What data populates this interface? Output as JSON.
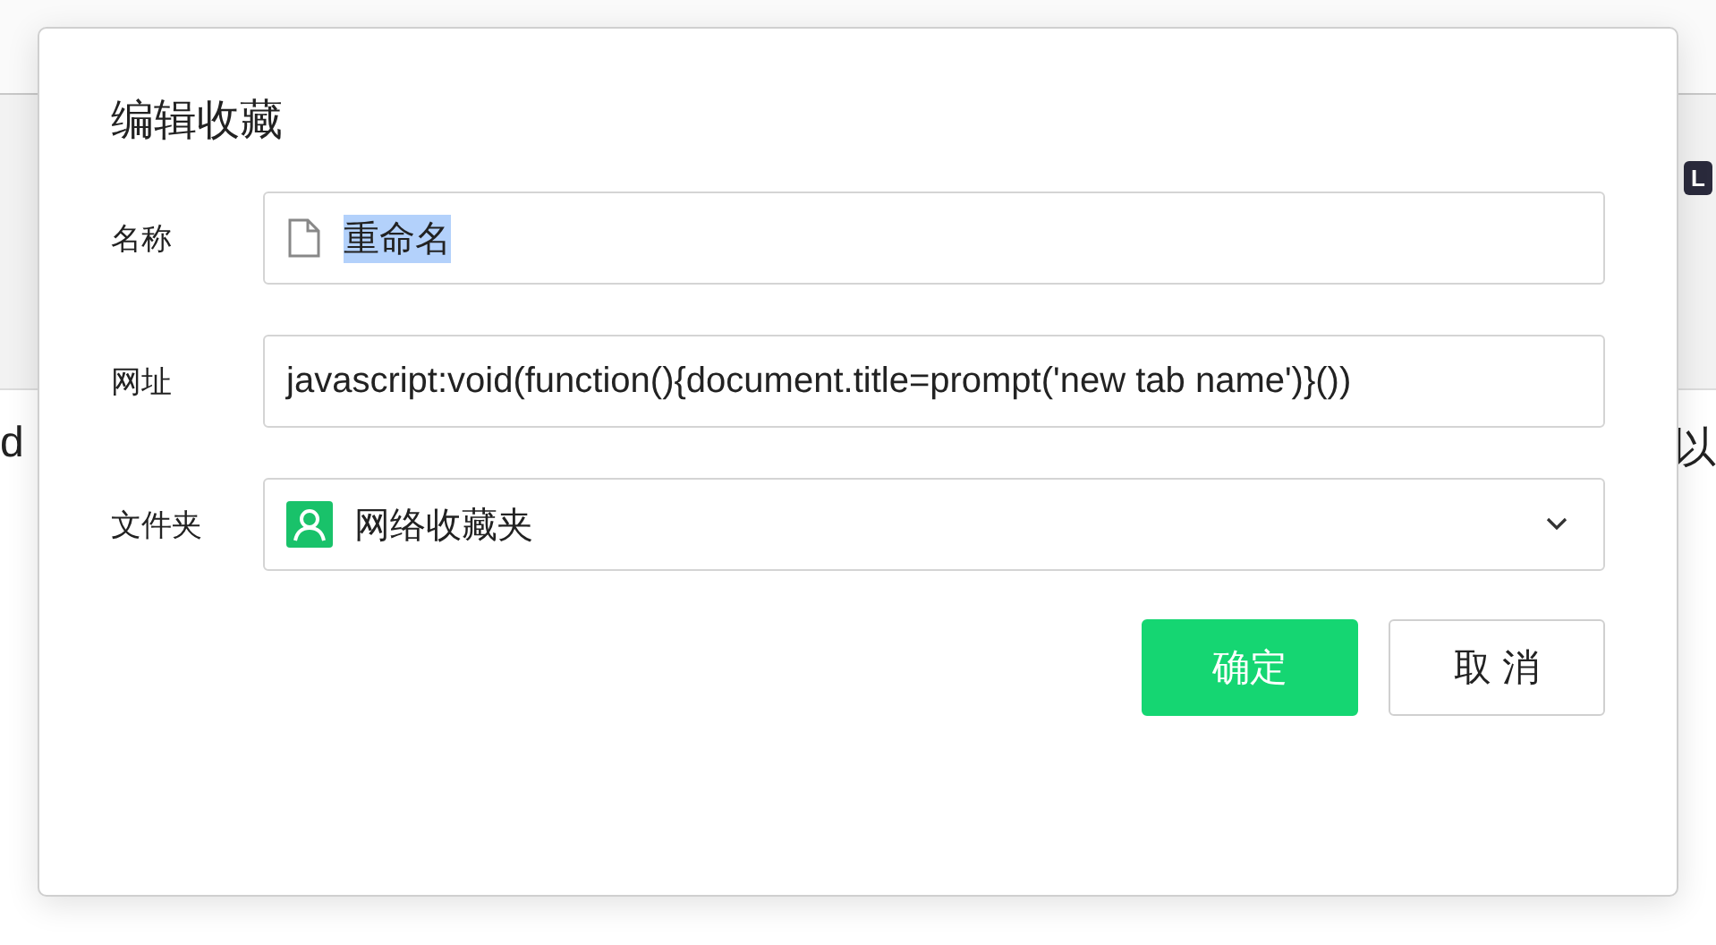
{
  "background": {
    "badge": "L",
    "left_text": "d",
    "right_text": "以"
  },
  "dialog": {
    "title": "编辑收藏",
    "fields": [
      {
        "kind": "text",
        "label": "名称",
        "value": "重命名",
        "value_selected": true
      },
      {
        "kind": "url",
        "label": "网址",
        "value": "javascript:void(function(){document.title=prompt('new tab name')}())"
      },
      {
        "kind": "select",
        "label": "文件夹",
        "value": "网络收藏夹"
      }
    ],
    "buttons": [
      {
        "label": "确定",
        "primary": true
      },
      {
        "label": "取 消",
        "primary": false
      }
    ]
  }
}
